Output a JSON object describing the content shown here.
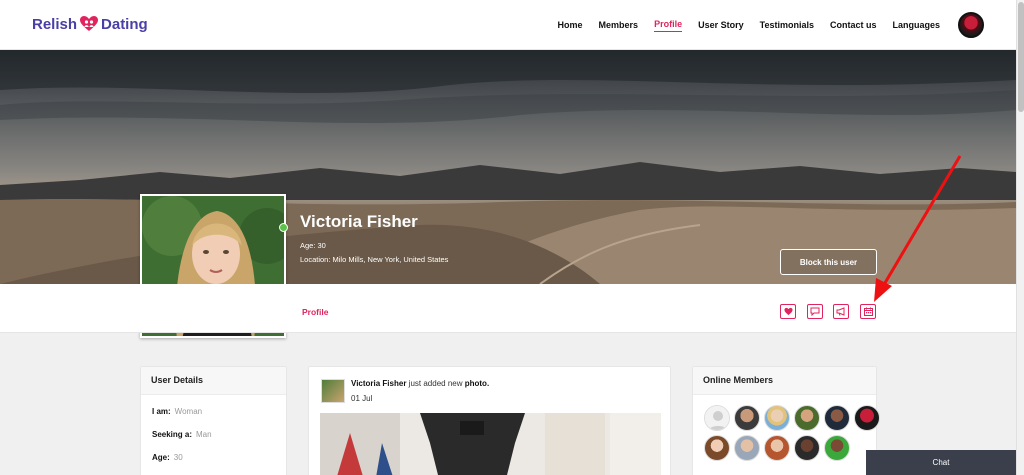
{
  "logo": {
    "text_left": "Relish",
    "text_right": "Dating",
    "brand_color": "#4a3fa6",
    "heart_icon": "heart-couple-icon",
    "heart_color": "#e0245e"
  },
  "nav": [
    {
      "label": "Home",
      "active": false
    },
    {
      "label": "Members",
      "active": false
    },
    {
      "label": "Profile",
      "active": true
    },
    {
      "label": "User Story",
      "active": false
    },
    {
      "label": "Testimonials",
      "active": false
    },
    {
      "label": "Contact us",
      "active": false
    },
    {
      "label": "Languages",
      "active": false
    }
  ],
  "accent_color": "#e0245e",
  "profile": {
    "name": "Victoria Fisher",
    "age": "Age: 30",
    "location": "Location: Milo Mills, New York, United States",
    "online": true,
    "block_button": "Block this user",
    "tab": "Profile",
    "actions": [
      {
        "icon": "heart-icon"
      },
      {
        "icon": "chat-bubble-icon"
      },
      {
        "icon": "megaphone-icon"
      },
      {
        "icon": "calendar-icon"
      }
    ]
  },
  "user_details": {
    "title": "User Details",
    "rows": [
      {
        "key": "I am:",
        "value": "Woman"
      },
      {
        "key": "Seeking a:",
        "value": "Man"
      },
      {
        "key": "Age:",
        "value": "30"
      }
    ]
  },
  "post": {
    "author": "Victoria Fisher",
    "action": "just added new",
    "object": "photo.",
    "date": "01 Jul"
  },
  "online_members": {
    "title": "Online Members",
    "count_shown": 10
  },
  "chat": {
    "label": "Chat"
  }
}
